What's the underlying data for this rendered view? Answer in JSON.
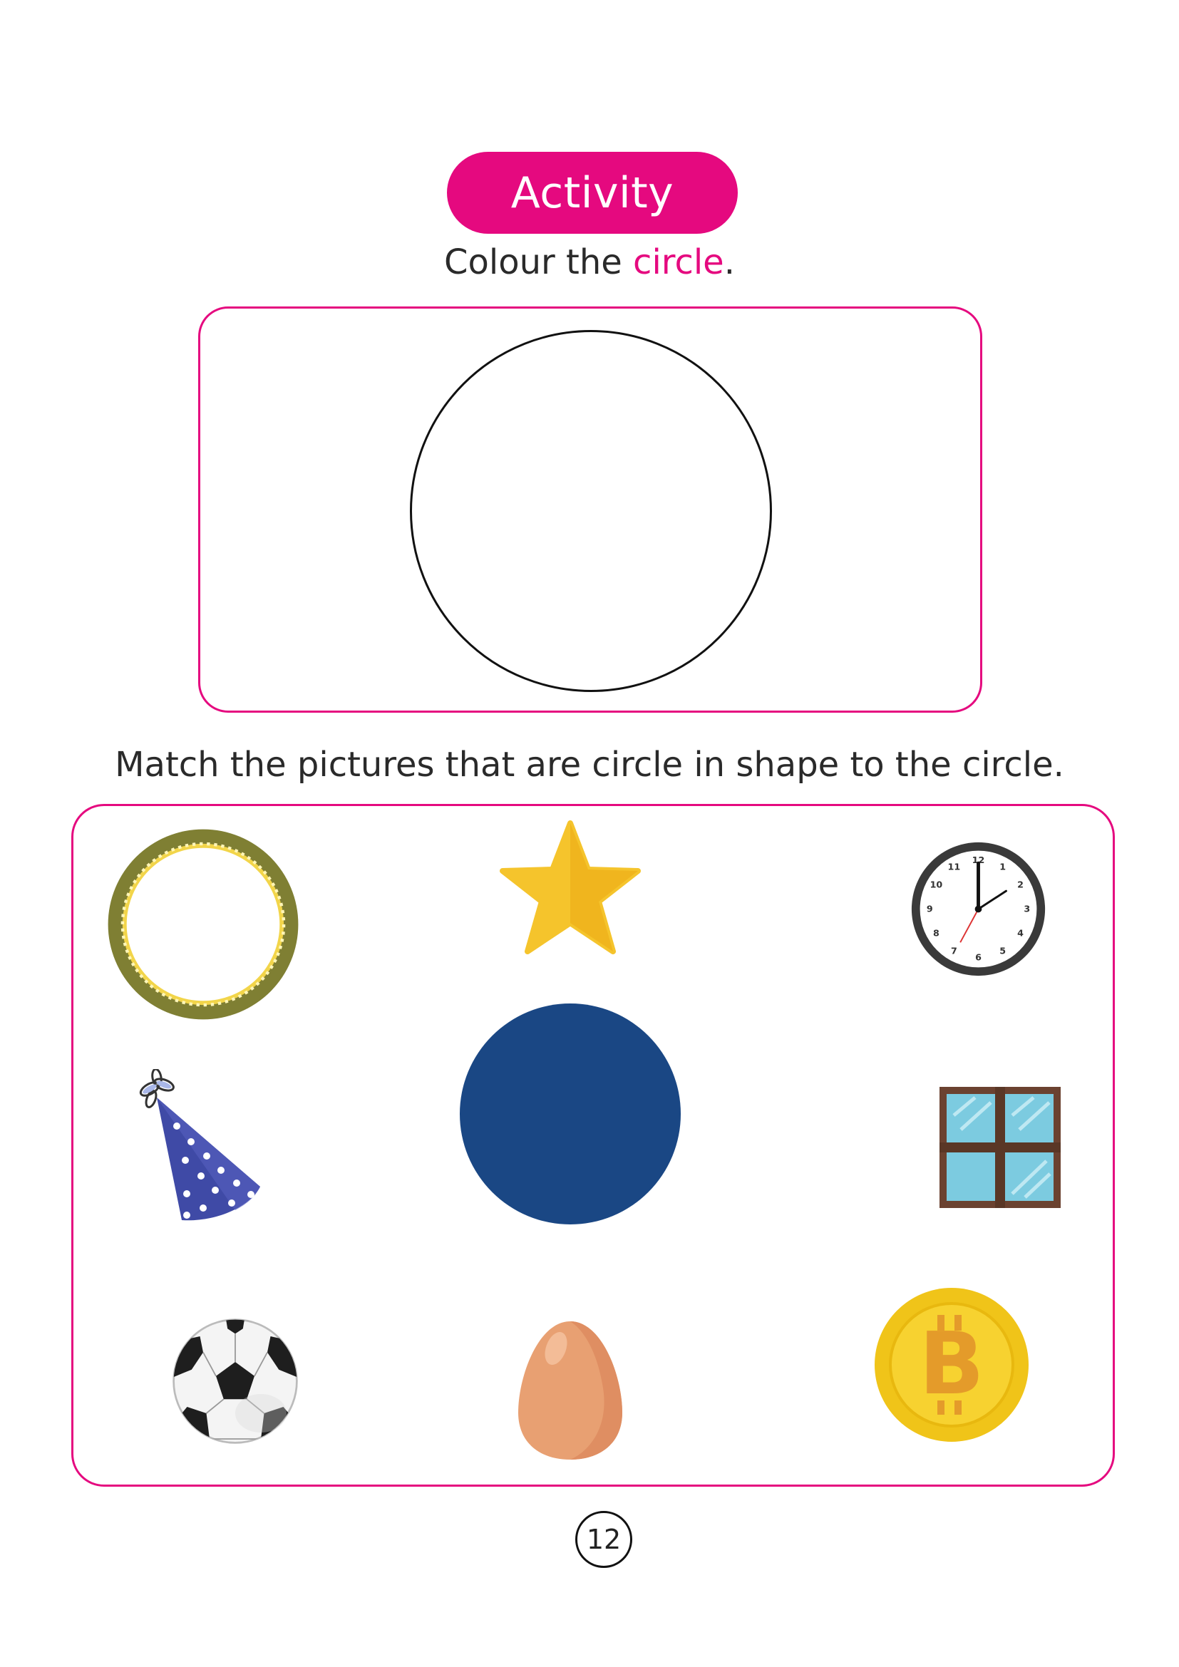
{
  "header": {
    "title": "Activity"
  },
  "colour_task": {
    "prefix": "Colour the ",
    "highlight": "circle",
    "suffix": "."
  },
  "match_task": {
    "text": "Match the pictures that are circle in shape to the circle."
  },
  "pictures": [
    {
      "name": "frame-icon"
    },
    {
      "name": "star-icon"
    },
    {
      "name": "clock-icon",
      "numbers": [
        "12",
        "1",
        "2",
        "3",
        "4",
        "5",
        "6",
        "7",
        "8",
        "9",
        "10",
        "11"
      ]
    },
    {
      "name": "party-hat-icon"
    },
    {
      "name": "blue-circle-icon"
    },
    {
      "name": "window-icon"
    },
    {
      "name": "football-icon"
    },
    {
      "name": "egg-icon"
    },
    {
      "name": "coin-icon",
      "symbol": "B"
    }
  ],
  "page": {
    "number": "12"
  },
  "colors": {
    "accent": "#e5097f",
    "navy": "#1a4784"
  }
}
